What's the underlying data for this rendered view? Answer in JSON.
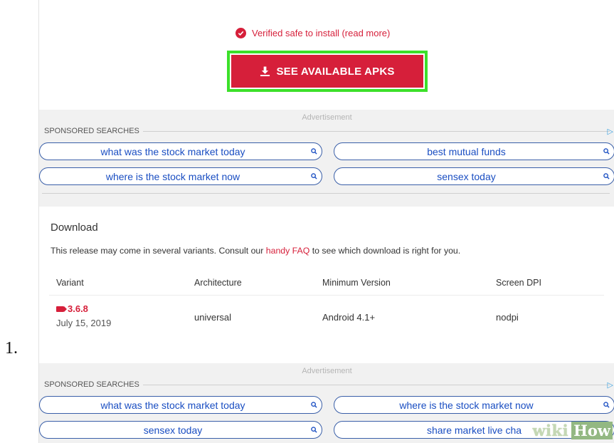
{
  "step_number": "1.",
  "verified_text": "Verified safe to install (read more)",
  "apk_button": "SEE AVAILABLE APKS",
  "ad_label": "Advertisement",
  "sponsored_label": "SPONSORED SEARCHES",
  "ad_choice": "▷",
  "ads_top": [
    "what was the stock market today",
    "best mutual funds",
    "where is the stock market now",
    "sensex today"
  ],
  "download": {
    "title": "Download",
    "desc_before": "This release may come in several variants. Consult our ",
    "desc_link": "handy FAQ",
    "desc_after": " to see which download is right for you.",
    "columns": [
      "Variant",
      "Architecture",
      "Minimum Version",
      "Screen DPI"
    ],
    "row": {
      "version": "3.6.8",
      "date": "July 15, 2019",
      "architecture": "universal",
      "min_version": "Android 4.1+",
      "dpi": "nodpi"
    }
  },
  "ads_bottom": [
    "what was the stock market today",
    "where is the stock market now",
    "sensex today",
    "share market live cha"
  ],
  "watermark": {
    "wiki": "wiki",
    "how": "How"
  },
  "colors": {
    "accent": "#d61f3a",
    "highlight": "#3ce02a",
    "link": "#1a4ec2"
  }
}
